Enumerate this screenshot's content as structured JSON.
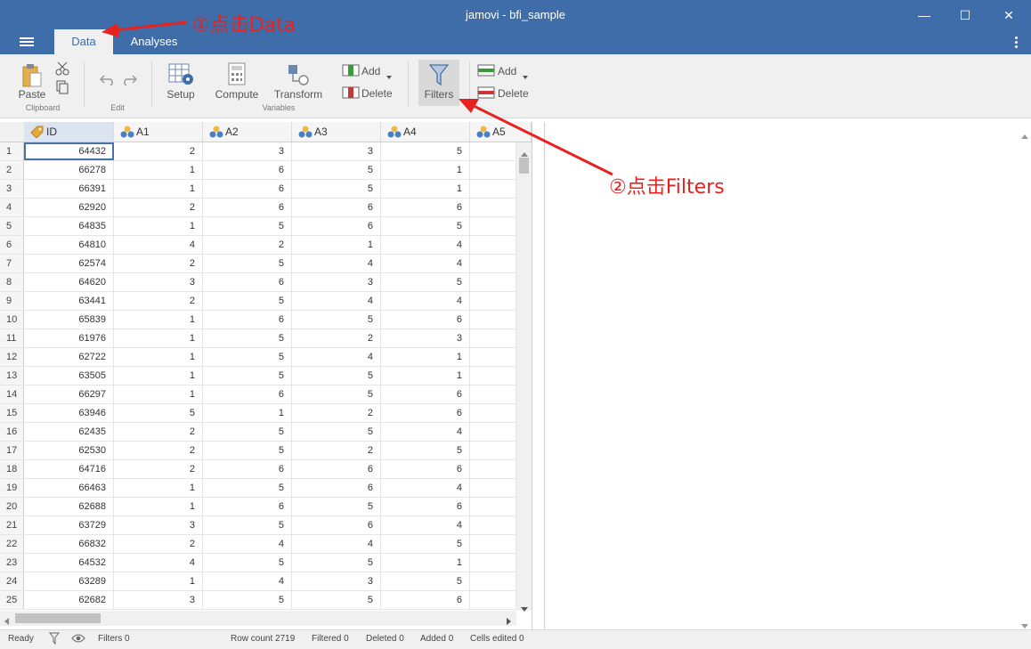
{
  "window": {
    "title": "jamovi - bfi_sample",
    "minimize": "—",
    "maximize": "☐",
    "close": "✕"
  },
  "tabs": {
    "data": "Data",
    "analyses": "Analyses"
  },
  "ribbon": {
    "paste": "Paste",
    "clipboard_group": "Clipboard",
    "edit_group": "Edit",
    "setup": "Setup",
    "compute": "Compute",
    "transform": "Transform",
    "variables_group": "Variables",
    "var_add": "Add",
    "var_delete": "Delete",
    "filters": "Filters",
    "row_add": "Add",
    "row_delete": "Delete"
  },
  "grid": {
    "columns": [
      "ID",
      "A1",
      "A2",
      "A3",
      "A4",
      "A5"
    ],
    "rows": [
      [
        "1",
        "64432",
        "2",
        "3",
        "3",
        "5"
      ],
      [
        "2",
        "66278",
        "1",
        "6",
        "5",
        "1"
      ],
      [
        "3",
        "66391",
        "1",
        "6",
        "5",
        "1"
      ],
      [
        "4",
        "62920",
        "2",
        "6",
        "6",
        "6"
      ],
      [
        "5",
        "64835",
        "1",
        "5",
        "6",
        "5"
      ],
      [
        "6",
        "64810",
        "4",
        "2",
        "1",
        "4"
      ],
      [
        "7",
        "62574",
        "2",
        "5",
        "4",
        "4"
      ],
      [
        "8",
        "64620",
        "3",
        "6",
        "3",
        "5"
      ],
      [
        "9",
        "63441",
        "2",
        "5",
        "4",
        "4"
      ],
      [
        "10",
        "65839",
        "1",
        "6",
        "5",
        "6"
      ],
      [
        "11",
        "61976",
        "1",
        "5",
        "2",
        "3"
      ],
      [
        "12",
        "62722",
        "1",
        "5",
        "4",
        "1"
      ],
      [
        "13",
        "63505",
        "1",
        "5",
        "5",
        "1"
      ],
      [
        "14",
        "66297",
        "1",
        "6",
        "5",
        "6"
      ],
      [
        "15",
        "63946",
        "5",
        "1",
        "2",
        "6"
      ],
      [
        "16",
        "62435",
        "2",
        "5",
        "5",
        "4"
      ],
      [
        "17",
        "62530",
        "2",
        "5",
        "2",
        "5"
      ],
      [
        "18",
        "64716",
        "2",
        "6",
        "6",
        "6"
      ],
      [
        "19",
        "66463",
        "1",
        "5",
        "6",
        "4"
      ],
      [
        "20",
        "62688",
        "1",
        "6",
        "5",
        "6"
      ],
      [
        "21",
        "63729",
        "3",
        "5",
        "6",
        "4"
      ],
      [
        "22",
        "66832",
        "2",
        "4",
        "4",
        "5"
      ],
      [
        "23",
        "64532",
        "4",
        "5",
        "5",
        "1"
      ],
      [
        "24",
        "63289",
        "1",
        "4",
        "3",
        "5"
      ],
      [
        "25",
        "62682",
        "3",
        "5",
        "5",
        "6"
      ]
    ]
  },
  "status": {
    "ready": "Ready",
    "filters": "Filters 0",
    "row_count": "Row count 2719",
    "filtered": "Filtered 0",
    "deleted": "Deleted 0",
    "added": "Added 0",
    "cells_edited": "Cells edited 0"
  },
  "annotations": {
    "step1": "①点击Data",
    "step2": "②点击Filters"
  },
  "colors": {
    "accent": "#3e6da9",
    "annotation": "#e8221e"
  }
}
